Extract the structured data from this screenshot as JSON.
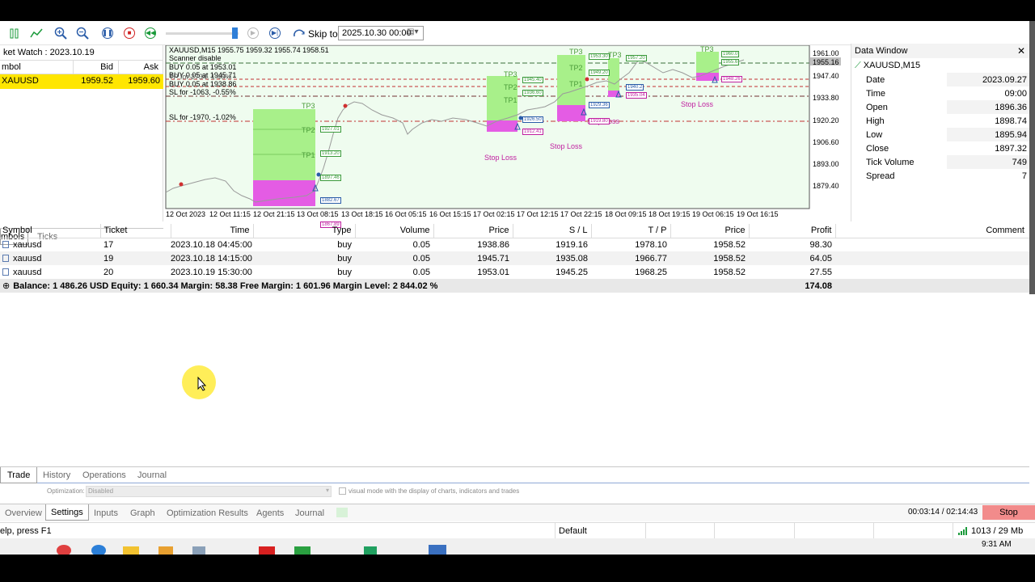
{
  "toolbar": {
    "skip_to_label": "Skip to",
    "skip_to_value": "2025.10.30 00:00"
  },
  "market_watch": {
    "title": "ket Watch : 2023.10.19",
    "columns": {
      "symbol": "mbol",
      "bid": "Bid",
      "ask": "Ask"
    },
    "row": {
      "symbol": "XAUUSD",
      "bid": "1959.52",
      "ask": "1959.60"
    },
    "tabs": [
      "mbols",
      "Ticks"
    ]
  },
  "chart": {
    "header": "XAUUSD,M15  1955.75 1959.32 1955.74 1958.51",
    "info_lines": [
      "Scanner disable",
      "BUY 0.05 at 1953.01",
      "BUY 0.05 at 1945.71",
      "BUY 0.05 at 1938.86",
      "SL for -1063, -0.55%",
      "SL for -1970, -1.02%"
    ],
    "info_overlap": "TP for 2734, 1.40%",
    "price_axis": [
      "1961.00",
      "1955.16",
      "1947.40",
      "1933.80",
      "1920.20",
      "1906.60",
      "1893.00",
      "1879.40"
    ],
    "time_axis": [
      "12 Oct 2023",
      "12 Oct 11:15",
      "12 Oct 21:15",
      "13 Oct 08:15",
      "13 Oct 18:15",
      "16 Oct 05:15",
      "16 Oct 15:15",
      "17 Oct 02:15",
      "17 Oct 12:15",
      "17 Oct 22:15",
      "18 Oct 09:15",
      "18 Oct 19:15",
      "19 Oct 06:15",
      "19 Oct 16:15"
    ],
    "zone_labels": {
      "tp3": "TP3",
      "tp2": "TP2",
      "tp1": "TP1",
      "stop_loss": "Stop Loss"
    },
    "price_tags": [
      "1927.01",
      "1913.20",
      "1897.46",
      "1882.67",
      "1867.89",
      "1945.40",
      "1936.60",
      "1926.50",
      "1912.41",
      "1953.30",
      "1949.20",
      "1929.36",
      "1919.80",
      "1957.20",
      "1940.2",
      "1935.04",
      "1960.0",
      "1955.6",
      "1948.26"
    ]
  },
  "data_window": {
    "title": "Data Window",
    "symbol": "XAUUSD,M15",
    "rows": [
      {
        "label": "Date",
        "value": "2023.09.27"
      },
      {
        "label": "Time",
        "value": "09:00"
      },
      {
        "label": "Open",
        "value": "1896.36"
      },
      {
        "label": "High",
        "value": "1898.74"
      },
      {
        "label": "Low",
        "value": "1895.94"
      },
      {
        "label": "Close",
        "value": "1897.32"
      },
      {
        "label": "Tick Volume",
        "value": "749"
      },
      {
        "label": "Spread",
        "value": "7"
      }
    ]
  },
  "trades": {
    "columns": [
      "Symbol",
      "Ticket",
      "Time",
      "Type",
      "Volume",
      "Price",
      "S / L",
      "T / P",
      "Price",
      "Profit",
      "Comment"
    ],
    "rows": [
      {
        "symbol": "xauusd",
        "ticket": "17",
        "time": "2023.10.18 04:45:00",
        "type": "buy",
        "volume": "0.05",
        "price": "1938.86",
        "sl": "1919.16",
        "tp": "1978.10",
        "cur_price": "1958.52",
        "profit": "98.30"
      },
      {
        "symbol": "xauusd",
        "ticket": "19",
        "time": "2023.10.18 14:15:00",
        "type": "buy",
        "volume": "0.05",
        "price": "1945.71",
        "sl": "1935.08",
        "tp": "1966.77",
        "cur_price": "1958.52",
        "profit": "64.05"
      },
      {
        "symbol": "xauusd",
        "ticket": "20",
        "time": "2023.10.19 15:30:00",
        "type": "buy",
        "volume": "0.05",
        "price": "1953.01",
        "sl": "1945.25",
        "tp": "1968.25",
        "cur_price": "1958.52",
        "profit": "27.55"
      }
    ],
    "summary": "Balance: 1 486.26 USD  Equity: 1 660.34  Margin: 58.38  Free Margin: 1 601.96  Margin Level: 2 844.02 %",
    "total_profit": "174.08"
  },
  "terminal_tabs": [
    "Trade",
    "History",
    "Operations",
    "Journal"
  ],
  "tester": {
    "optimization_label": "Optimization:",
    "optimization_value": "Disabled",
    "visual_mode": "visual mode with the display of charts, indicators and trades",
    "tabs": [
      "Overview",
      "Settings",
      "Inputs",
      "Graph",
      "Optimization Results",
      "Agents",
      "Journal"
    ],
    "timer": "00:03:14 / 02:14:43",
    "stop_label": "Stop"
  },
  "statusbar": {
    "help": "elp, press F1",
    "profile": "Default",
    "traffic": "1013 / 29 Mb"
  },
  "taskbar": {
    "time": "9:31 AM"
  },
  "colors": {
    "accent_yellow": "#ffe600",
    "tp_green": "#a8f08a",
    "sl_magenta": "#e45ce4",
    "chart_bg": "#effcef",
    "stop_red": "#f28b8b"
  }
}
